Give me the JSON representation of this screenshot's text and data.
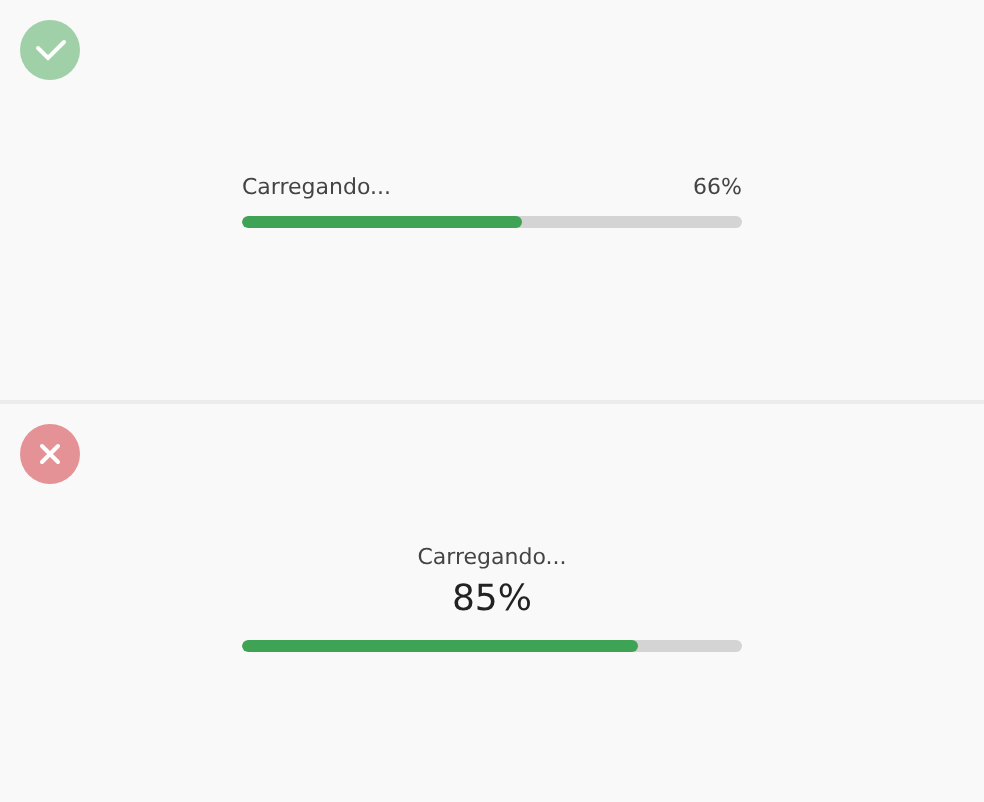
{
  "panels": [
    {
      "kind": "inline",
      "icon": {
        "kind": "success"
      },
      "label": "Carregando...",
      "reading": "66%",
      "level": 0.56
    },
    {
      "kind": "stacked",
      "icon": {
        "kind": "error"
      },
      "label": "Carregando...",
      "reading": "85%",
      "level": 0.79
    }
  ]
}
